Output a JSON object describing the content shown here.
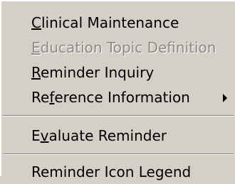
{
  "menu": {
    "items": [
      {
        "label": "Clinical Maintenance",
        "accelerator": "C",
        "enabled": true
      },
      {
        "label": "Education Topic Definition",
        "accelerator": "E",
        "enabled": false
      },
      {
        "label": "Reminder Inquiry",
        "accelerator": "R",
        "enabled": true
      },
      {
        "label": "Reference Information",
        "accelerator": "f",
        "enabled": true,
        "submenu": true
      },
      {
        "label": "Evaluate Reminder",
        "accelerator": "v",
        "enabled": true
      },
      {
        "label": "Reminder Icon Legend",
        "accelerator": "",
        "enabled": true
      }
    ]
  },
  "colors": {
    "menu_background": "#d4d0c8",
    "disabled_text": "#8c8a84"
  },
  "icons": {
    "submenu": "submenu-arrow-icon"
  }
}
